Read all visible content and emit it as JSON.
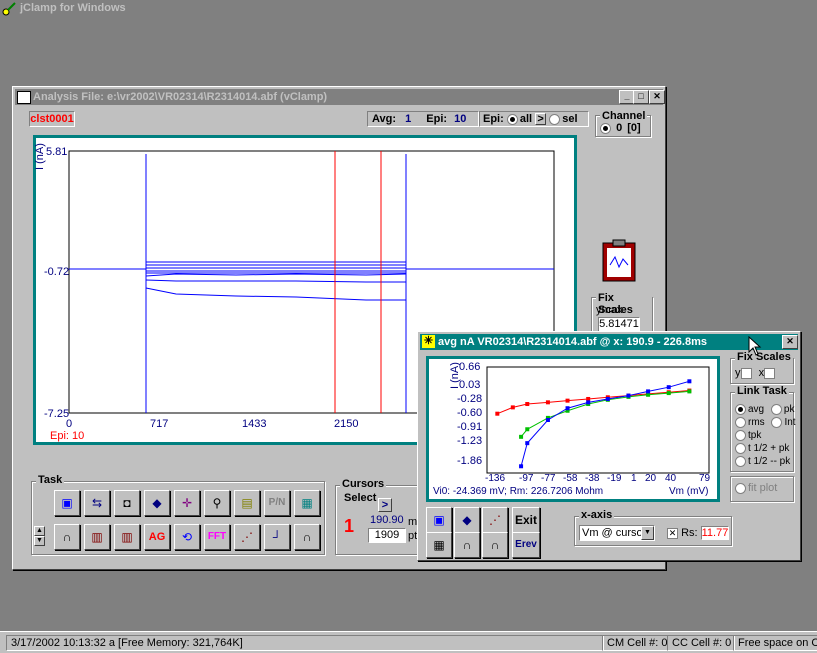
{
  "app": {
    "title": "jClamp for Windows"
  },
  "analysis": {
    "title": "Analysis  File: e:\\vr2002\\VR02314\\R2314014.abf (vClamp)",
    "cluster": "clst0001",
    "avg_label": "Avg:",
    "avg_value": "1",
    "epi_label": "Epi:",
    "epi_value": "10",
    "epi_mode_label": "Epi:",
    "epi_all": "all",
    "epi_next": ">",
    "epi_sel": "sel",
    "channel_title": "Channel",
    "channel_value": "0",
    "channel_index": "[0]",
    "plot": {
      "ylabel": "I (nA)",
      "yticks": [
        "5.81",
        "-0.72",
        "-7.25"
      ],
      "xticks": [
        "0",
        "717",
        "1433",
        "2150"
      ],
      "epi_label": "Epi: 10"
    },
    "fixscales": {
      "title": "Fix Scales",
      "ymax_label": "ymax:",
      "ymax_value": "5.81471"
    },
    "task_title": "Task",
    "task_buttons": [
      "P/N",
      "AG",
      "FFT"
    ],
    "cursors": {
      "title": "Cursors",
      "select_label": "Select",
      "select_btn": ">",
      "number": "1",
      "value_ms": "190.90",
      "unit_ms": "ms",
      "value_pt": "1909",
      "unit_pt": "pt"
    }
  },
  "iv": {
    "title": "avg nA VR02314\\R2314014.abf @ x: 190.9 -  226.8ms",
    "plot": {
      "ylabel": "I (nA)",
      "xlabel": "Vm (mV)",
      "yticks": [
        "0.66",
        "0.03",
        "-0.28",
        "-0.60",
        "-0.91",
        "-1.23",
        "-1.86"
      ],
      "xticks": [
        "-136",
        "-97",
        "-77",
        "-58",
        "-38",
        "-19",
        "1",
        "20",
        "40",
        "79"
      ],
      "footer": "Vi0: -24.369 mV; Rm:  226.7206 Mohm"
    },
    "fixscales": {
      "title": "Fix Scales",
      "y": "y",
      "x": "x"
    },
    "linktask": {
      "title": "Link Task",
      "opts": [
        "avg",
        "pk",
        "rms",
        "Int",
        "tpk",
        "t 1/2 + pk",
        "t 1/2 -- pk"
      ]
    },
    "fit_plot": "fit plot",
    "btn_exit": "Exit",
    "btn_erev": "Erev",
    "xaxis": {
      "title": "x-axis",
      "value": "Vm @ cursor",
      "rs_label": "Rs:",
      "rs_value": "11.77"
    }
  },
  "status": {
    "datetime": "3/17/2002 10:13:32 a",
    "memory": "[Free Memory: 321,764K]",
    "cm_cell": "CM Cell #:  0",
    "cc_cell": "CC Cell #:  0",
    "free_space": "Free space on C:"
  },
  "chart_data": {
    "type": "line",
    "xlabel": "Vm (mV)",
    "ylabel": "I (nA)",
    "xlim": [
      -136,
      79
    ],
    "ylim": [
      -1.86,
      0.66
    ],
    "series": [
      {
        "color": "#ff0000",
        "x": [
          -126,
          -111,
          -97,
          -77,
          -58,
          -38,
          -19,
          1,
          20,
          40,
          60
        ],
        "y": [
          -0.45,
          -0.3,
          -0.22,
          -0.18,
          -0.14,
          -0.1,
          -0.06,
          -0.02,
          0.02,
          0.06,
          0.1
        ]
      },
      {
        "color": "#00c000",
        "x": [
          -103,
          -97,
          -77,
          -58,
          -38,
          -19,
          1,
          20,
          40,
          60
        ],
        "y": [
          -1.0,
          -0.82,
          -0.55,
          -0.38,
          -0.22,
          -0.12,
          -0.05,
          0.0,
          0.04,
          0.08
        ]
      },
      {
        "color": "#0000ff",
        "x": [
          -103,
          -97,
          -77,
          -58,
          -38,
          -19,
          1,
          20,
          40,
          60
        ],
        "y": [
          -1.7,
          -1.15,
          -0.6,
          -0.32,
          -0.18,
          -0.1,
          -0.02,
          0.08,
          0.18,
          0.32
        ]
      }
    ]
  }
}
